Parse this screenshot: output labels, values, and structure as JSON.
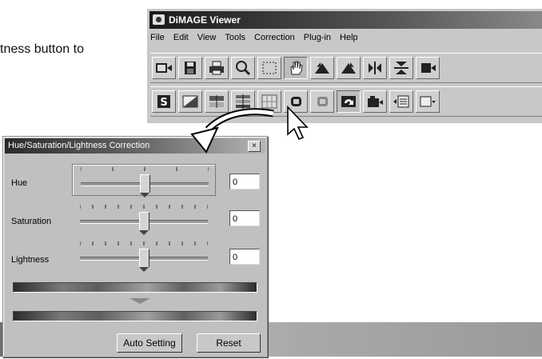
{
  "manual": {
    "fragment_text": "tness button to"
  },
  "viewer": {
    "title": "DiMAGE Viewer",
    "menu": [
      "File",
      "Edit",
      "View",
      "Tools",
      "Correction",
      "Plug-in",
      "Help"
    ]
  },
  "toolbar1_icons": [
    "open-image-icon",
    "save-icon",
    "print-icon",
    "magnifier-icon",
    "selection-rectangle-icon",
    "hand-icon",
    "rotate-left-icon",
    "rotate-right-icon",
    "flip-horizontal-icon",
    "flip-vertical-icon",
    "overflow-icon"
  ],
  "toolbar2_icons": [
    "variations-icon",
    "brightness-contrast-icon",
    "color-balance-icon",
    "hue-saturation-lightness-icon",
    "tone-curve-icon",
    "undo-icon",
    "redo-icon",
    "original-icon",
    "snapshot-icon",
    "export-icon",
    "more-icon"
  ],
  "dialog": {
    "title": "Hue/Saturation/Lightness Correction",
    "close_label": "×",
    "sliders": [
      {
        "label": "Hue",
        "value": "0",
        "position": 0.5
      },
      {
        "label": "Saturation",
        "value": "0",
        "position": 0.5
      },
      {
        "label": "Lightness",
        "value": "0",
        "position": 0.5
      }
    ],
    "auto_button": "Auto Setting",
    "reset_button": "Reset"
  }
}
